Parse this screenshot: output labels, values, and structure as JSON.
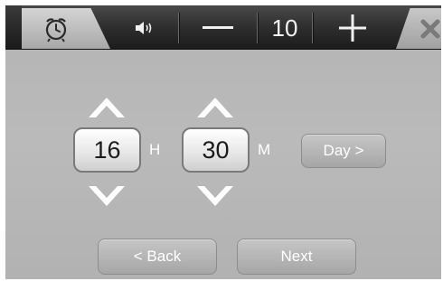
{
  "topbar": {
    "alarm_tab_icon": "alarm-clock-icon",
    "speaker_icon": "speaker-icon",
    "minus_icon": "minus-icon",
    "volume_value": "10",
    "plus_icon": "plus-icon",
    "close_icon": "close-icon"
  },
  "time": {
    "hour": "16",
    "hour_unit": "H",
    "minute": "30",
    "minute_unit": "M",
    "day_button_label": "Day >"
  },
  "nav": {
    "back_label": "< Back",
    "next_label": "Next"
  },
  "colors": {
    "panel_background": "#b6b6b6",
    "topbar_dark": "#2a2a2a",
    "text_light": "#ffffff"
  }
}
